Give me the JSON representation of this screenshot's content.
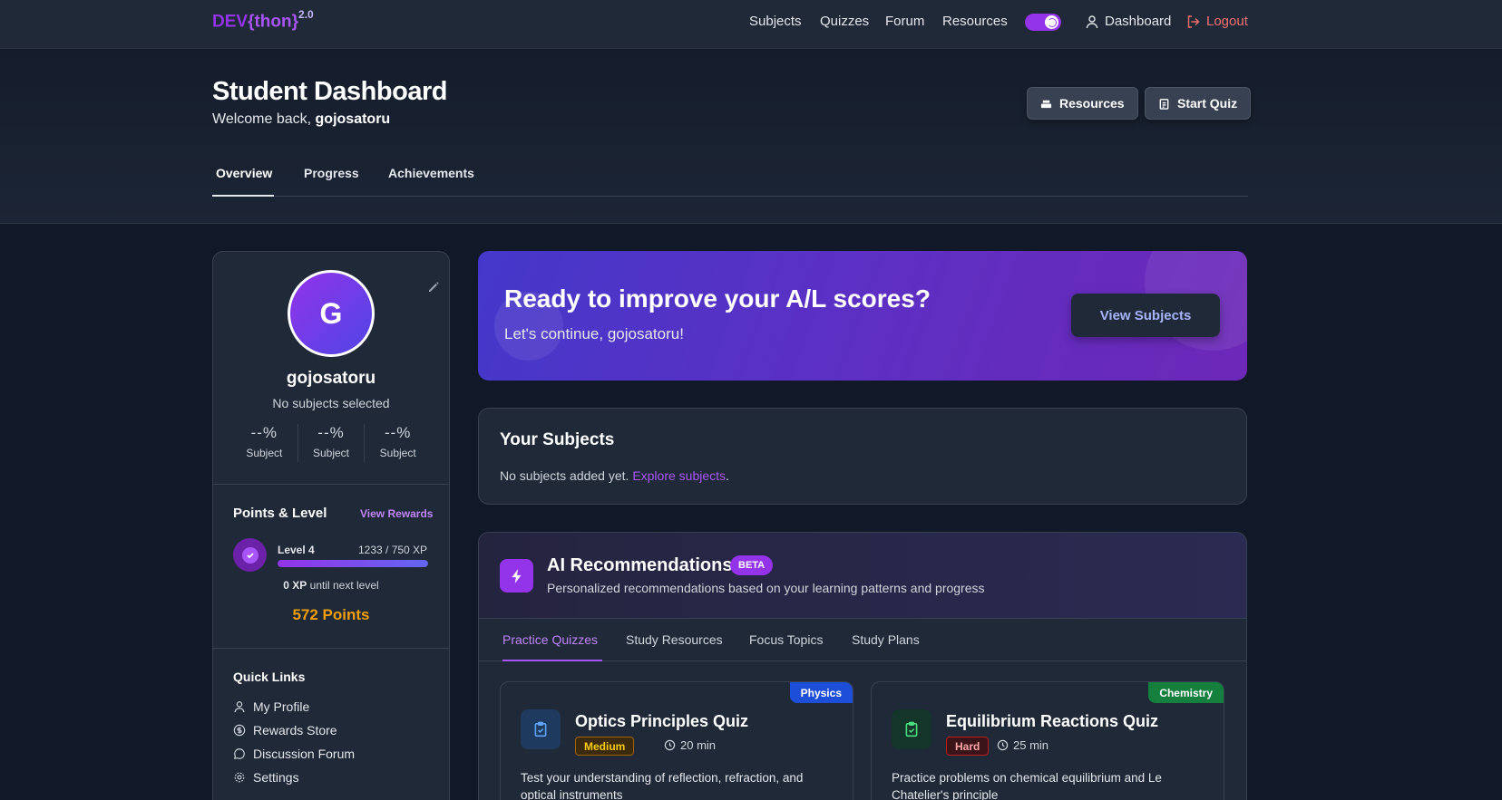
{
  "nav": {
    "brand_a": "DEV",
    "brand_b": "{thon}",
    "brand_sup": "2.0",
    "links": [
      "Subjects",
      "Quizzes",
      "Forum",
      "Resources"
    ],
    "dashboard": "Dashboard",
    "logout": "Logout"
  },
  "header": {
    "title": "Student Dashboard",
    "welcome_prefix": "Welcome back,",
    "username": "gojosatoru",
    "resources_btn": "Resources",
    "start_quiz_btn": "Start Quiz",
    "tabs": [
      "Overview",
      "Progress",
      "Achievements"
    ],
    "active_tab": "Overview"
  },
  "profile": {
    "initial": "G",
    "name": "gojosatoru",
    "subtitle": "No subjects selected",
    "stats": [
      {
        "value": "--%",
        "label": "Subject"
      },
      {
        "value": "--%",
        "label": "Subject"
      },
      {
        "value": "--%",
        "label": "Subject"
      }
    ],
    "points_title": "Points & Level",
    "view_rewards": "View Rewards",
    "level": "Level 4",
    "xp": "1233 / 750 XP",
    "xp_progress": 1.0,
    "next_level_value": "0 XP",
    "next_level_text": "until next level",
    "points": "572 Points",
    "quick_links_title": "Quick Links",
    "quick_links": [
      "My Profile",
      "Rewards Store",
      "Discussion Forum",
      "Settings"
    ]
  },
  "hero": {
    "title": "Ready to improve your A/L scores?",
    "subtitle": "Let's continue, gojosatoru!",
    "button": "View Subjects"
  },
  "subjects": {
    "title": "Your Subjects",
    "empty_text": "No subjects added yet.",
    "explore_link": "Explore subjects",
    "period": "."
  },
  "ai": {
    "title": "AI Recommendations",
    "badge": "BETA",
    "description": "Personalized recommendations based on your learning patterns and progress",
    "tabs": [
      "Practice Quizzes",
      "Study Resources",
      "Focus Topics",
      "Study Plans"
    ],
    "active_tab": "Practice Quizzes",
    "quizzes": [
      {
        "tag": "Physics",
        "tag_color": "#1d4ed8",
        "title": "Optics Principles Quiz",
        "difficulty": "Medium",
        "duration": "20 min",
        "description": "Test your understanding of reflection, refraction, and optical instruments"
      },
      {
        "tag": "Chemistry",
        "tag_color": "#15803d",
        "title": "Equilibrium Reactions Quiz",
        "difficulty": "Hard",
        "duration": "25 min",
        "description": "Practice problems on chemical equilibrium and Le Chatelier's principle"
      }
    ]
  },
  "colors": {
    "accent": "#9333ea",
    "background": "#111827",
    "card": "#1f2937",
    "points": "#f59e0b",
    "logout": "#f87171"
  }
}
